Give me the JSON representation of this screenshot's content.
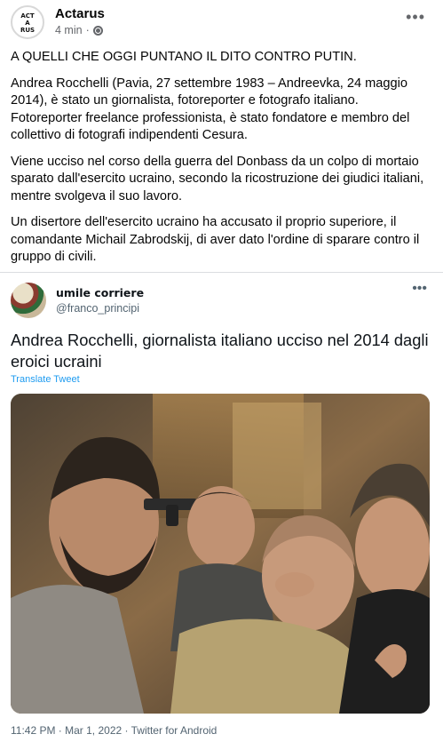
{
  "post": {
    "author": "Actarus",
    "time": "4 min",
    "separator": "·",
    "avatar_logo": [
      "ACT",
      "A",
      "RUS"
    ],
    "paragraphs": [
      "A QUELLI CHE OGGI PUNTANO IL DITO CONTRO PUTIN.",
      "Andrea Rocchelli (Pavia, 27 settembre 1983 – Andreevka, 24 maggio 2014), è stato un giornalista, fotoreporter e fotografo italiano. Fotoreporter freelance professionista, è stato fondatore e membro del collettivo di fotografi indipendenti Cesura.",
      "Viene ucciso nel corso della guerra del Donbass da un colpo di mortaio sparato dall'esercito ucraino, secondo la ricostruzione dei giudici italiani, mentre svolgeva il suo lavoro.",
      "Un disertore dell'esercito ucraino ha accusato il proprio superiore, il comandante Michail Zabrodskij, di aver dato l'ordine di sparare contro il gruppo di civili."
    ],
    "more_icon": "more-horizontal-icon"
  },
  "tweet": {
    "name": "umile corriere",
    "handle": "@franco_principi",
    "text": "Andrea Rocchelli, giornalista italiano ucciso nel 2014 dagli eroici ucraini",
    "translate_label": "Translate Tweet",
    "timestamp": "11:42 PM · Mar 1, 2022 · Twitter for Android",
    "photo_description_icon": "group-photo-image"
  },
  "colors": {
    "link_blue": "#1d9bf0",
    "meta_gray": "#65676b",
    "divider": "#dadde1"
  }
}
